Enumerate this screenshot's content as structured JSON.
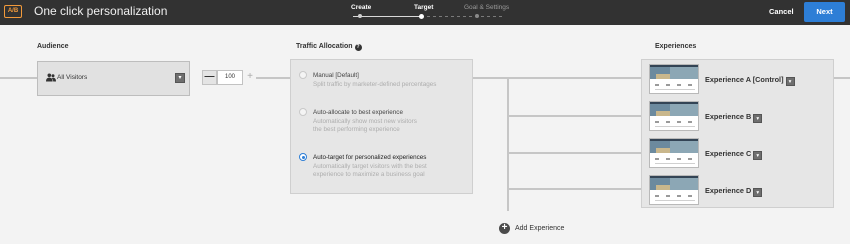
{
  "header": {
    "badge": "A/B",
    "title": "One click personalization",
    "steps": [
      {
        "label": "Create"
      },
      {
        "label": "Target"
      },
      {
        "label": "Goal & Settings"
      }
    ],
    "cancel_label": "Cancel",
    "next_label": "Next"
  },
  "audience": {
    "heading": "Audience",
    "selected": "All Visitors",
    "dropdown_glyph": "▾",
    "stepper_value": "100",
    "minus_glyph": "—",
    "plus_glyph": "+"
  },
  "traffic": {
    "heading": "Traffic Allocation",
    "help_glyph": "?",
    "options": [
      {
        "title": "Manual [Default]",
        "description": "Split traffic by marketer-defined percentages",
        "checked": false
      },
      {
        "title": "Auto-allocate to best experience",
        "description": "Automatically show most new visitors the best performing experience",
        "checked": false
      },
      {
        "title": "Auto-target for personalized experiences",
        "description": "Automatically target visitors with the best experience to maximize a business goal",
        "checked": true
      }
    ]
  },
  "experiences": {
    "heading": "Experiences",
    "items": [
      {
        "label": "Experience A [Control]"
      },
      {
        "label": "Experience B"
      },
      {
        "label": "Experience C"
      },
      {
        "label": "Experience D"
      }
    ],
    "dropdown_glyph": "▾",
    "add_label": "Add Experience",
    "add_glyph": "+"
  },
  "colors": {
    "topbar": "#323232",
    "accent": "#2d7ed6",
    "badge": "#f29a3b",
    "background": "#f3f3f3"
  }
}
